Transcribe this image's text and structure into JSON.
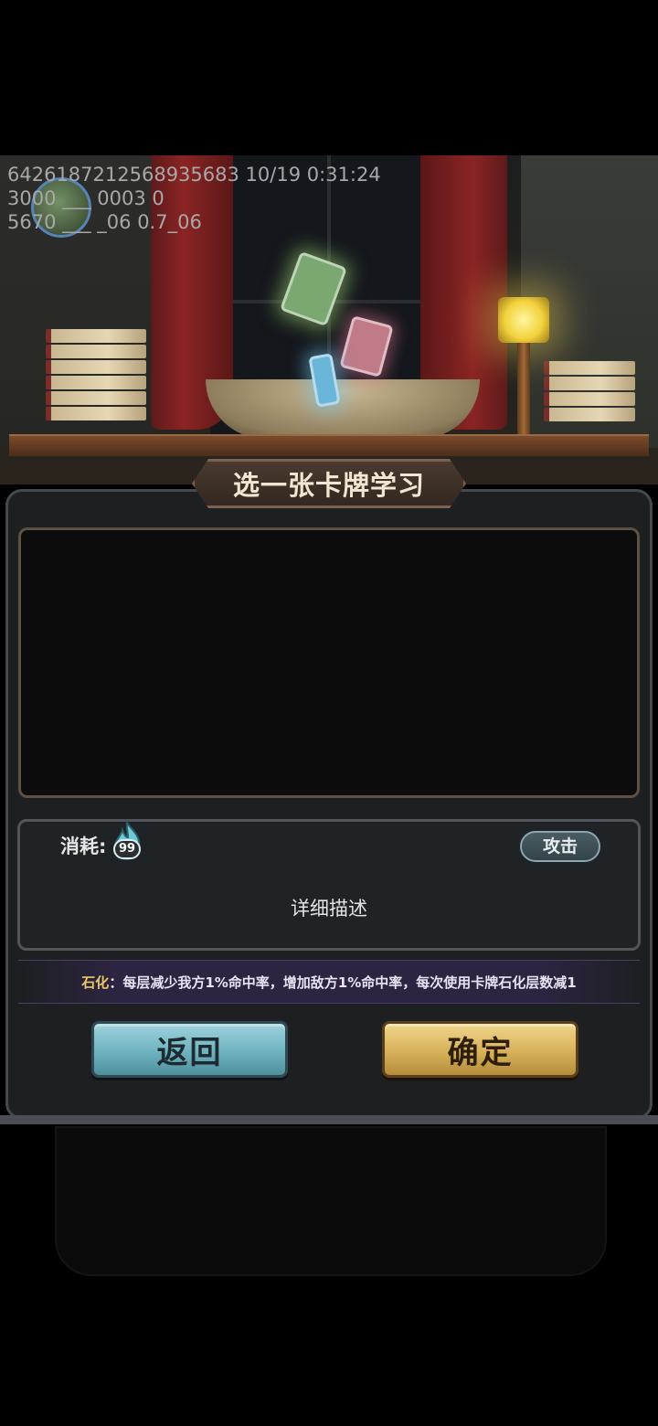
{
  "debug": {
    "line1": "6426187212568935683 10/19 0:31:24",
    "line2": "3000 ___ 0003 0",
    "line3": "5670 ___ _06 0.7_06"
  },
  "dialog": {
    "title": "选一张卡牌学习"
  },
  "card_info": {
    "cost_label": "消耗:",
    "cost_value": "99",
    "type_badge": "攻击",
    "description": "详细描述"
  },
  "effect": {
    "keyword": "石化",
    "text": "：每层减少我方1%命中率，增加敌方1%命中率，每次使用卡牌石化层数减1"
  },
  "buttons": {
    "back_label": "返回",
    "confirm_label": "确定"
  },
  "icons": {
    "mana": "blue-flame-mana-icon",
    "avatar": "player-avatar"
  },
  "colors": {
    "back_button": "#6fb3c0",
    "confirm_button": "#d8b15a",
    "effect_keyword": "#e9c76a"
  }
}
